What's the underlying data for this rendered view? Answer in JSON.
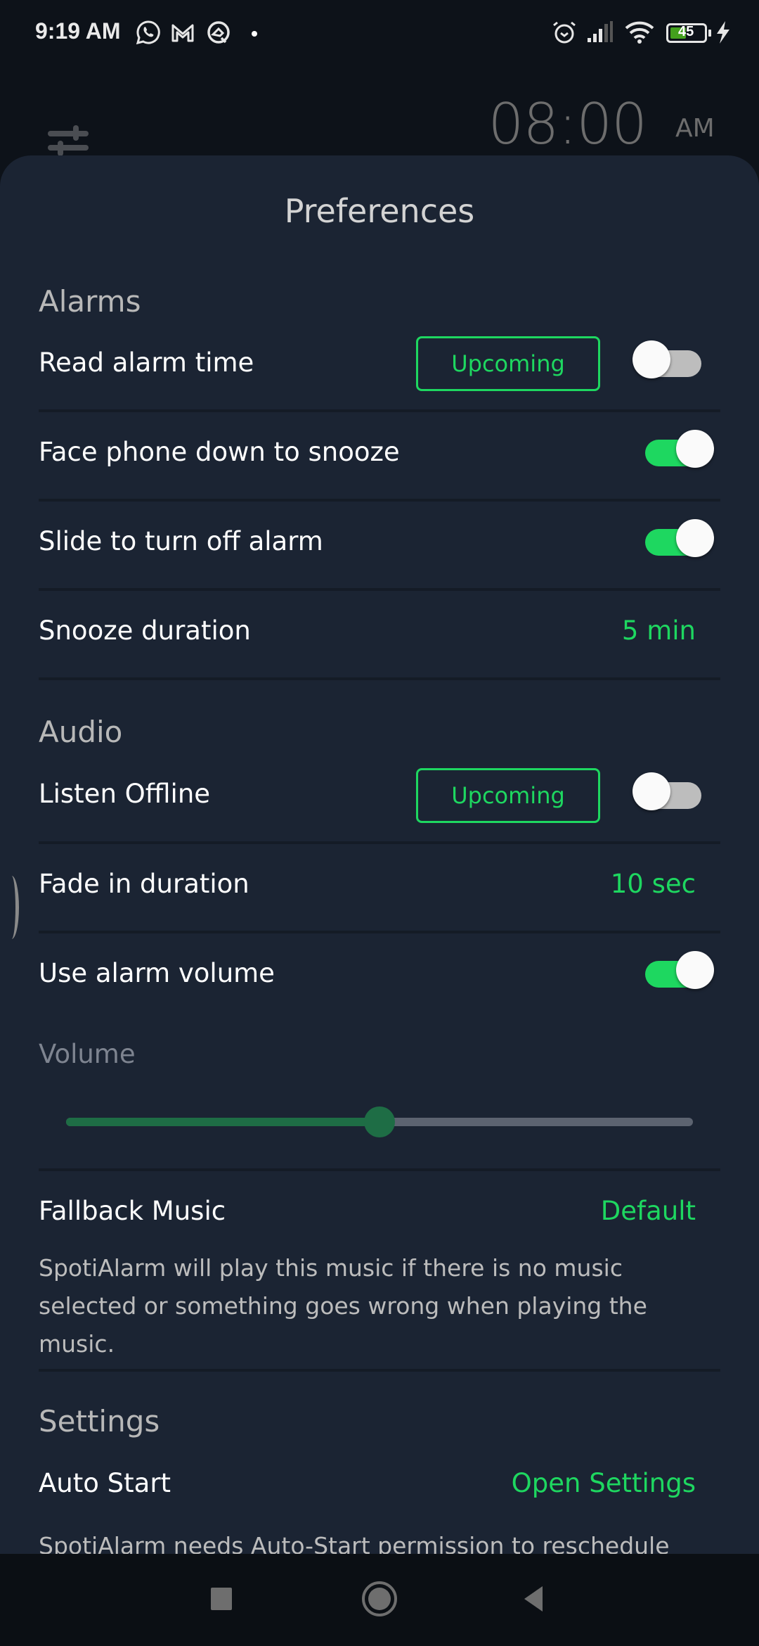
{
  "status_bar": {
    "time": "9:19 AM",
    "notification_icons": [
      "whatsapp-icon",
      "gmail-icon",
      "q-app-icon",
      "dot-icon"
    ],
    "system_icons": [
      "alarm-clock-icon",
      "signal-icon",
      "wifi-icon",
      "battery-icon",
      "charging-bolt-icon"
    ],
    "battery_level": "45"
  },
  "background": {
    "alarm_time": "08:00",
    "alarm_ampm": "AM",
    "settings_icon": "tune-sliders-icon"
  },
  "sheet": {
    "title": "Preferences",
    "sections": {
      "alarms": {
        "title": "Alarms",
        "read_alarm_time": {
          "label": "Read alarm time",
          "badge": "Upcoming",
          "enabled": false
        },
        "face_down_snooze": {
          "label": "Face phone down to snooze",
          "enabled": true
        },
        "slide_to_turn_off": {
          "label": "Slide to turn off alarm",
          "enabled": true
        },
        "snooze_duration": {
          "label": "Snooze duration",
          "value": "5 min"
        }
      },
      "audio": {
        "title": "Audio",
        "listen_offline": {
          "label": "Listen Offline",
          "badge": "Upcoming",
          "enabled": false
        },
        "fade_in_duration": {
          "label": "Fade in duration",
          "value": "10 sec"
        },
        "use_alarm_volume": {
          "label": "Use alarm volume",
          "enabled": true
        },
        "volume": {
          "label": "Volume",
          "value_fraction": 0.5
        },
        "fallback_music": {
          "label": "Fallback Music",
          "value": "Default",
          "description": "SpotiAlarm will play this music if there is no music selected or something goes wrong when playing the music."
        }
      },
      "settings": {
        "title": "Settings",
        "auto_start": {
          "label": "Auto Start",
          "value": "Open Settings",
          "description": "SpotiAlarm needs Auto-Start permission to reschedule"
        }
      }
    }
  },
  "nav_bar": {
    "buttons": [
      "recents-icon",
      "home-icon",
      "back-icon"
    ]
  },
  "colors": {
    "accent": "#1ed760",
    "sheet_bg": "#1b2433",
    "screen_bg": "#0d1219",
    "slider_fill": "#1e6d45",
    "slider_track": "#5c6370",
    "toggle_off": "#bdbdbd"
  }
}
